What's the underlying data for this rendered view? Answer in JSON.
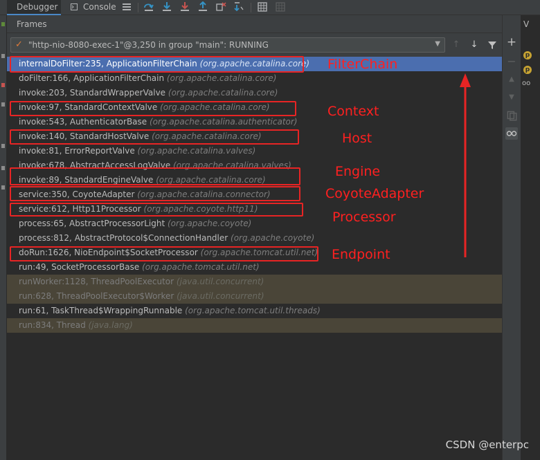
{
  "toolbar": {
    "debugger_tab": "Debugger",
    "console_tab": "Console",
    "icons": [
      "menu-icon",
      "step-over-icon",
      "step-into-icon",
      "force-step-into-icon",
      "step-out-icon",
      "drop-frame-icon",
      "run-to-cursor-icon",
      "evaluate-icon",
      "more-icon"
    ]
  },
  "frames": {
    "title": "Frames",
    "thread": "\"http-nio-8080-exec-1\"@3,250 in group \"main\": RUNNING",
    "rows": [
      {
        "method": "internalDoFilter:235, ApplicationFilterChain",
        "pkg": "(org.apache.catalina.core)",
        "state": "selected"
      },
      {
        "method": "doFilter:166, ApplicationFilterChain",
        "pkg": "(org.apache.catalina.core)",
        "state": "normal"
      },
      {
        "method": "invoke:203, StandardWrapperValve",
        "pkg": "(org.apache.catalina.core)",
        "state": "normal"
      },
      {
        "method": "invoke:97, StandardContextValve",
        "pkg": "(org.apache.catalina.core)",
        "state": "normal"
      },
      {
        "method": "invoke:543, AuthenticatorBase",
        "pkg": "(org.apache.catalina.authenticator)",
        "state": "normal"
      },
      {
        "method": "invoke:140, StandardHostValve",
        "pkg": "(org.apache.catalina.core)",
        "state": "normal"
      },
      {
        "method": "invoke:81, ErrorReportValve",
        "pkg": "(org.apache.catalina.valves)",
        "state": "normal"
      },
      {
        "method": "invoke:678, AbstractAccessLogValve",
        "pkg": "(org.apache.catalina.valves)",
        "state": "normal"
      },
      {
        "method": "invoke:89, StandardEngineValve",
        "pkg": "(org.apache.catalina.core)",
        "state": "normal"
      },
      {
        "method": "service:350, CoyoteAdapter",
        "pkg": "(org.apache.catalina.connector)",
        "state": "normal"
      },
      {
        "method": "service:612, Http11Processor",
        "pkg": "(org.apache.coyote.http11)",
        "state": "normal"
      },
      {
        "method": "process:65, AbstractProcessorLight",
        "pkg": "(org.apache.coyote)",
        "state": "normal"
      },
      {
        "method": "process:812, AbstractProtocol$ConnectionHandler",
        "pkg": "(org.apache.coyote)",
        "state": "normal"
      },
      {
        "method": "doRun:1626, NioEndpoint$SocketProcessor",
        "pkg": "(org.apache.tomcat.util.net)",
        "state": "normal"
      },
      {
        "method": "run:49, SocketProcessorBase",
        "pkg": "(org.apache.tomcat.util.net)",
        "state": "normal"
      },
      {
        "method": "runWorker:1128, ThreadPoolExecutor",
        "pkg": "(java.util.concurrent)",
        "state": "library"
      },
      {
        "method": "run:628, ThreadPoolExecutor$Worker",
        "pkg": "(java.util.concurrent)",
        "state": "library"
      },
      {
        "method": "run:61, TaskThread$WrappingRunnable",
        "pkg": "(org.apache.tomcat.util.threads)",
        "state": "normal"
      },
      {
        "method": "run:834, Thread",
        "pkg": "(java.lang)",
        "state": "library"
      }
    ]
  },
  "variables_panel": {
    "title": "V",
    "item_badges": [
      "p",
      "p"
    ]
  },
  "annotations": {
    "labels": [
      "FilterChain",
      "Context",
      "Host",
      "Engine",
      "CoyoteAdapter",
      "Processor",
      "Endpoint"
    ],
    "color": "#ff2020"
  },
  "watermark": "CSDN @enterpc",
  "colors": {
    "selected_row": "#4b6eaf",
    "library_row": "#4a4538",
    "background": "#2b2b2b",
    "annotation": "#e82424"
  }
}
